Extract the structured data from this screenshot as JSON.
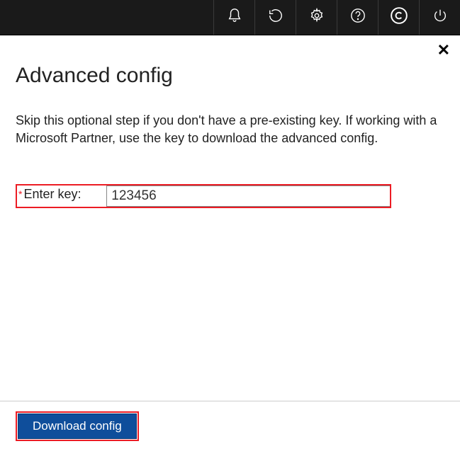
{
  "topbar": {
    "icons": [
      "bell-icon",
      "refresh-icon",
      "gear-icon",
      "help-icon",
      "copyright-icon",
      "power-icon"
    ]
  },
  "panel": {
    "title": "Advanced config",
    "description": "Skip this optional step if you don't have a pre-existing key. If working with a Microsoft Partner, use the key to download the advanced config.",
    "field": {
      "required_marker": "*",
      "label": "Enter key:",
      "value": "123456"
    },
    "button_label": "Download config",
    "close_label": "✕"
  }
}
